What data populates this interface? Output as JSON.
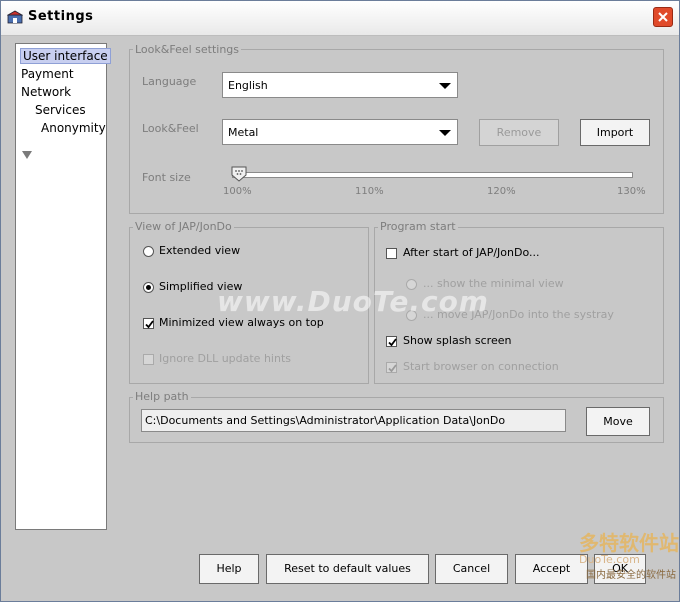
{
  "window": {
    "title": "Settings"
  },
  "nav": {
    "items": [
      "User interface",
      "Payment",
      "Network",
      "Services",
      "Anonymity"
    ]
  },
  "lookfeel": {
    "legend": "Look&Feel settings",
    "language_label": "Language",
    "language_value": "English",
    "lookfeel_label": "Look&Feel",
    "lookfeel_value": "Metal",
    "remove_label": "Remove",
    "import_label": "Import",
    "fontsize_label": "Font size",
    "fontsize_ticks": [
      "100%",
      "110%",
      "120%",
      "130%"
    ],
    "fontsize_value": "100%"
  },
  "view": {
    "legend": "View of JAP/JonDo",
    "extended": "Extended view",
    "simplified": "Simplified view",
    "minimized_on_top": "Minimized view always on top",
    "ignore_dll": "Ignore DLL update hints",
    "selected": "Simplified view"
  },
  "program_start": {
    "legend": "Program start",
    "after_start": "After start of JAP/JonDo...",
    "show_minimal": "... show the minimal view",
    "move_systray": "... move JAP/JonDo into the systray",
    "splash": "Show splash screen",
    "start_browser": "Start browser on connection"
  },
  "help_path": {
    "legend": "Help path",
    "value": "C:\\Documents and Settings\\Administrator\\Application Data\\JonDo",
    "move_label": "Move"
  },
  "footer": {
    "help": "Help",
    "reset": "Reset to default values",
    "cancel": "Cancel",
    "accept": "Accept",
    "ok": "OK"
  },
  "watermark": {
    "main": "www.DuoTe.com",
    "logo_cn": "多特软件站",
    "logo_en": "DuoTe.com",
    "logo_tag": "国内最安全的软件站"
  },
  "colors": {
    "close": "#e04a2a",
    "selection": "#c8cff0"
  }
}
